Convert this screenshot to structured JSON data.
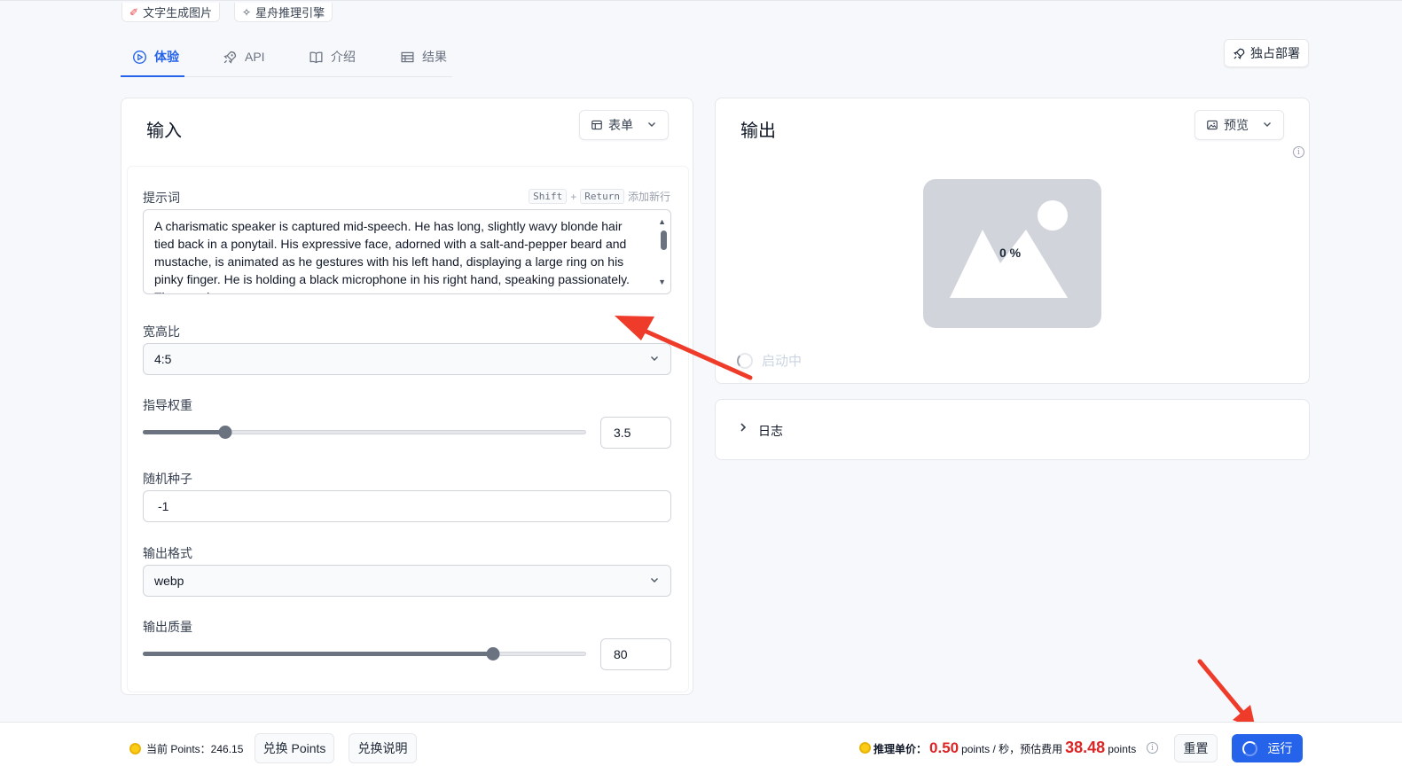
{
  "top_chips": {
    "text_to_image": "文字生成图片",
    "xingzhou_engine": "星舟推理引擎"
  },
  "tabs": [
    {
      "label": "体验",
      "icon": "play-circle-icon",
      "active": true
    },
    {
      "label": "API",
      "icon": "rocket-icon",
      "active": false
    },
    {
      "label": "介绍",
      "icon": "book-icon",
      "active": false
    },
    {
      "label": "结果",
      "icon": "table-icon",
      "active": false
    }
  ],
  "deploy_button": {
    "label": "独占部署",
    "icon": "rocket-icon"
  },
  "input_panel": {
    "title": "输入",
    "view_select": {
      "label": "表单",
      "icon": "table-icon"
    },
    "prompt": {
      "label": "提示词",
      "hint_keys": [
        "Shift",
        "+",
        "Return"
      ],
      "hint_text": "添加新行",
      "value": "A charismatic speaker is captured mid-speech. He has long, slightly wavy blonde hair tied back in a ponytail. His expressive face, adorned with a salt-and-pepper beard and mustache, is animated as he gestures with his left hand, displaying a large ring on his pinky finger. He is holding a black microphone in his right hand, speaking passionately. The man is wea"
    },
    "aspect_ratio": {
      "label": "宽高比",
      "value": "4:5"
    },
    "guidance": {
      "label": "指导权重",
      "value": "3.5",
      "fraction": 0.185
    },
    "seed": {
      "label": "随机种子",
      "value": "-1"
    },
    "output_format": {
      "label": "输出格式",
      "value": "webp"
    },
    "output_quality": {
      "label": "输出质量",
      "value": "80",
      "fraction": 0.79
    }
  },
  "output_panel": {
    "title": "输出",
    "view_select": {
      "label": "预览",
      "icon": "image-icon"
    },
    "progress": "0 %",
    "status": "启动中"
  },
  "log_panel": {
    "label": "日志"
  },
  "bottom_bar": {
    "points_label": "当前 Points：246.15",
    "redeem_button": "兑换 Points",
    "redeem_info_button": "兑换说明",
    "unit_price_label": "推理单价：",
    "unit_price_value": "0.50",
    "unit_price_suffix": "points / 秒，预估费用",
    "estimated_cost": "38.48",
    "cost_suffix": "points",
    "reset_button": "重置",
    "run_button": "运行"
  },
  "colors": {
    "accent": "#2563eb",
    "arrow": "#ef3b2a",
    "price_red": "#dc2626"
  }
}
